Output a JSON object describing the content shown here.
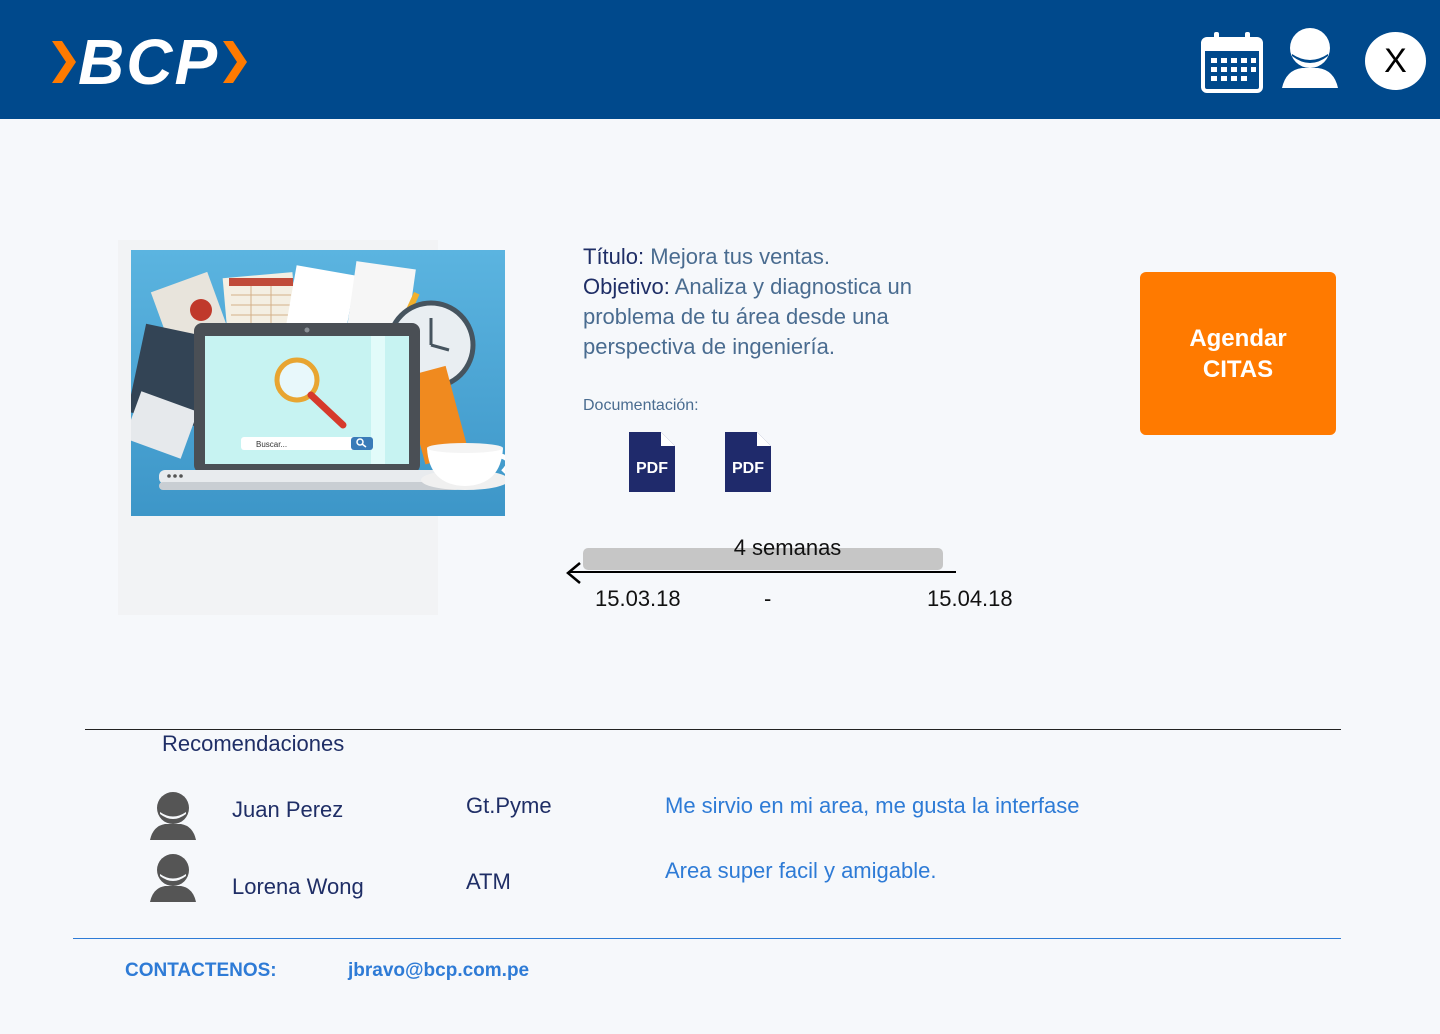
{
  "header": {
    "brand": "BCP",
    "close_label": "X",
    "icons": [
      "calendar-icon",
      "user-icon"
    ]
  },
  "course": {
    "title_label": "Título:",
    "title_value": "Mejora tus ventas.",
    "objective_label": "Objetivo:",
    "objective_value": "Analiza y diagnostica un problema de tu área desde una perspectiva de ingeniería.",
    "docs_label": "Documentación:",
    "docs": [
      {
        "label": "PDF"
      },
      {
        "label": "PDF"
      }
    ],
    "hero_search_placeholder": "Buscar..."
  },
  "cta": {
    "line1": "Agendar",
    "line2": "CITAS"
  },
  "timeline": {
    "duration": "4 semanas",
    "start": "15.03.18",
    "separator": "-",
    "end": "15.04.18"
  },
  "recommendations": {
    "title": "Recomendaciones",
    "items": [
      {
        "name": "Juan Perez",
        "area": "Gt.Pyme",
        "comment": "Me sirvio en mi area, me gusta la interfase"
      },
      {
        "name": "Lorena Wong",
        "area": "ATM",
        "comment": "Area super facil y amigable."
      }
    ]
  },
  "contact": {
    "label": "CONTACTENOS:",
    "email": "jbravo@bcp.com.pe"
  },
  "colors": {
    "header": "#00498c",
    "accent": "#ff7a00",
    "link": "#2e7bd6",
    "text_dark": "#1f2e66",
    "text_muted": "#4a6c90"
  }
}
